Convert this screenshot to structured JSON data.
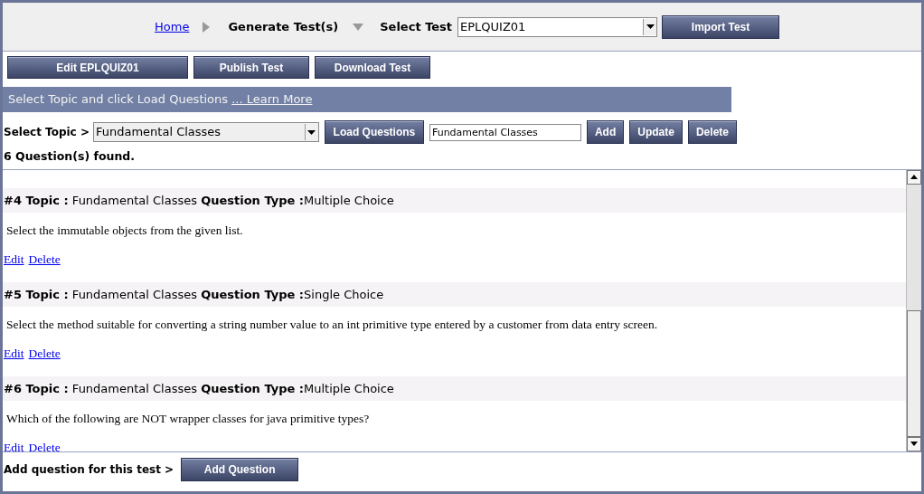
{
  "breadcrumb": {
    "home": "Home",
    "current": "Generate Test(s)"
  },
  "test_select": {
    "label": "Select Test",
    "value": "EPLQUIZ01"
  },
  "import_button": "Import Test",
  "action_buttons": [
    "Edit EPLQUIZ01",
    "Publish Test",
    "Download Test"
  ],
  "info_bar": {
    "text": "Select Topic and click Load Questions ",
    "link": "... Learn More"
  },
  "topic_row": {
    "label": "Select Topic >",
    "value": "Fundamental Classes",
    "load_button": "Load Questions",
    "topic_field": "Fundamental Classes",
    "buttons": [
      "Add",
      "Update",
      "Delete"
    ]
  },
  "found": "6 Question(s) found.",
  "questions": [
    {
      "heading": "**#4 Topic :** Fundamental Classes **Question Type :**Multiple Choice",
      "text": "Select the immutable objects from the given list.",
      "links": [
        "Edit",
        "Delete"
      ]
    },
    {
      "heading": "**#5 Topic :** Fundamental Classes **Question Type :**Single Choice",
      "text": "Select the method suitable for converting a string number value to an int primitive type entered by a customer from data entry screen.",
      "links": [
        "Edit",
        "Delete"
      ]
    },
    {
      "heading": "**#6 Topic :** Fundamental Classes **Question Type :**Multiple Choice",
      "text": "Which of the following are NOT wrapper classes for java primitive types?",
      "links": [
        "Edit",
        "Delete"
      ]
    }
  ],
  "footer": {
    "label": "Add question for this test >",
    "button": "Add Question"
  }
}
